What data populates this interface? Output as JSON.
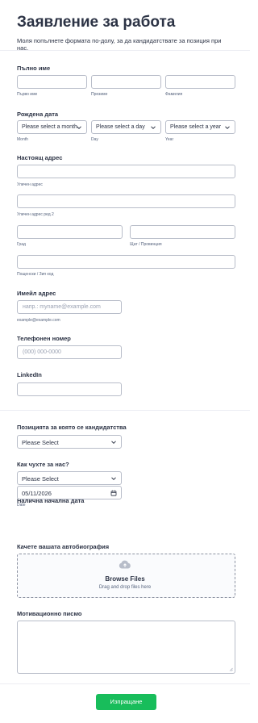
{
  "header": {
    "title": "Заявление за работа",
    "subtitle": "Моля попълнете формата по-долу, за да кандидатствате за позиция при нас."
  },
  "full_name": {
    "label": "Пълно име",
    "first_sub": "Първо име",
    "middle_sub": "Презиме",
    "last_sub": "Фамилия"
  },
  "birth_date": {
    "label": "Рождена дата",
    "month_value": "Please select a month",
    "day_value": "Please select a day",
    "year_value": "Please select a year",
    "month_sub": "Month",
    "day_sub": "Day",
    "year_sub": "Year"
  },
  "address": {
    "label": "Настоящ адрес",
    "street_sub": "Уличен адрес",
    "street2_sub": "Уличен адрес ред 2",
    "city_sub": "Град",
    "state_sub": "Щат / Провинция",
    "zip_sub": "Пощенски / Зип код"
  },
  "email": {
    "label": "Имейл адрес",
    "placeholder": "напр.: myname@example.com",
    "sub": "example@example.com"
  },
  "phone": {
    "label": "Телефонен номер",
    "placeholder": "(000) 000-0000"
  },
  "linkedin": {
    "label": "LinkedIn"
  },
  "position": {
    "label": "Позицията за която се кандидатства",
    "value": "Please Select"
  },
  "source": {
    "label": "Как чухте за нас?",
    "value": "Please Select"
  },
  "start_date": {
    "label": "Налична начална дата",
    "value": "05/11/2026",
    "sub": "Date"
  },
  "resume": {
    "label": "Качете вашата автобиография",
    "browse": "Browse Files",
    "hint": "Drag and drop files here"
  },
  "cover_letter": {
    "label": "Мотивационно писмо"
  },
  "submit_label": "Изпращане",
  "colors": {
    "accent": "#18bd5b",
    "text": "#2c3345",
    "border": "#b8bdc9"
  }
}
